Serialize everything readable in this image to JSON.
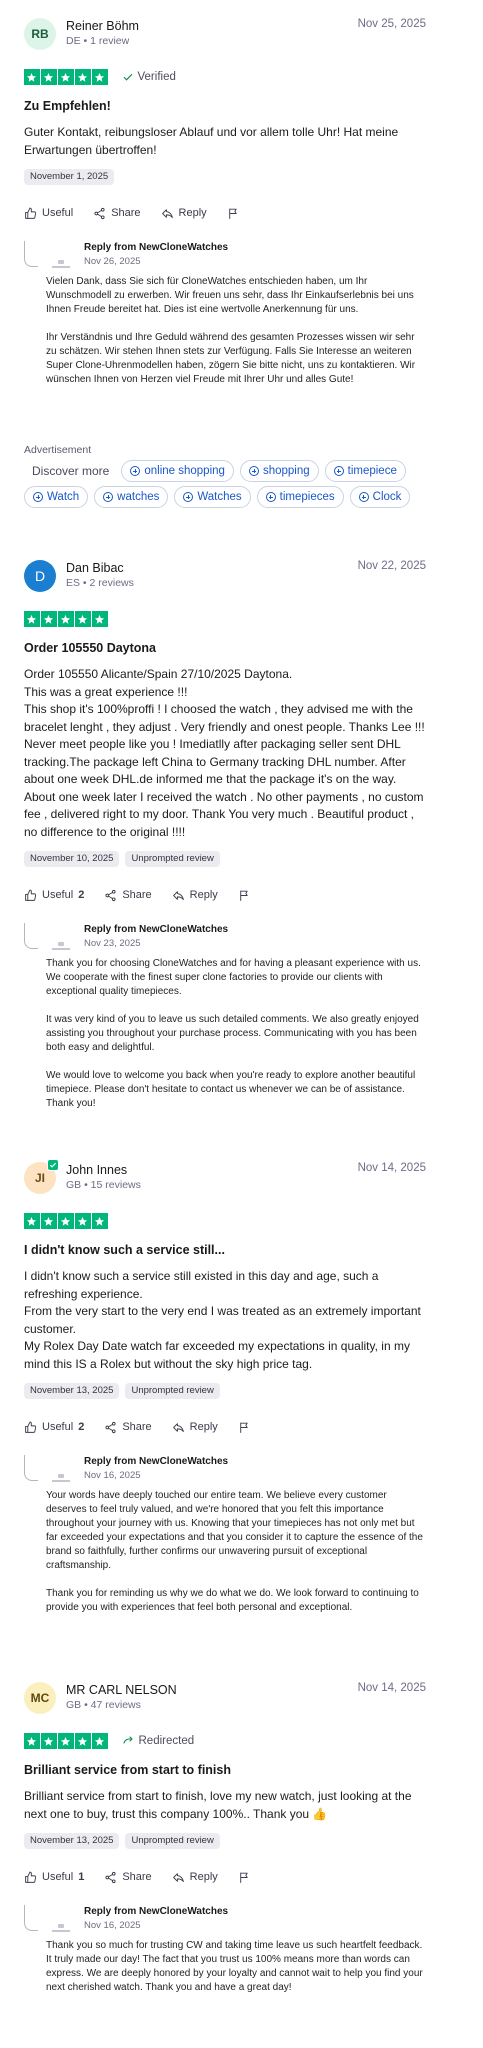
{
  "colors": {
    "star": "#00b67a",
    "link": "#1a57c9"
  },
  "actions": {
    "useful": "Useful",
    "share": "Share",
    "reply": "Reply"
  },
  "reviews": [
    {
      "initials": "RB",
      "avatar_bg": "#dcf5e8",
      "avatar_fg": "#1e5b3a",
      "name": "Reiner Böhm",
      "meta": "DE • 1 review",
      "date": "Nov 25, 2025",
      "rating": 5,
      "status": "Verified",
      "title": "Zu Empfehlen!",
      "body": "Guter Kontakt, reibungsloser Ablauf und vor allem tolle Uhr! Hat meine Erwartungen übertroffen!",
      "tags": [
        "November 1, 2025"
      ],
      "useful_count": "",
      "reply": {
        "from": "Reply from NewCloneWatches",
        "date": "Nov 26, 2025",
        "body": "Vielen Dank, dass Sie sich für CloneWatches entschieden haben, um Ihr Wunschmodell zu erwerben. Wir freuen uns sehr, dass Ihr Einkaufserlebnis bei uns Ihnen Freude bereitet hat. Dies ist eine wertvolle Anerkennung für uns.\n\nIhr Verständnis und Ihre Geduld während des gesamten Prozesses wissen wir sehr zu schätzen. Wir stehen Ihnen stets zur Verfügung. Falls Sie Interesse an weiteren Super Clone-Uhrenmodellen haben, zögern Sie bitte nicht, uns zu kontaktieren. Wir wünschen Ihnen von Herzen viel Freude mit Ihrer Uhr und alles Gute!"
      }
    },
    {
      "initials": "D",
      "avatar_bg": "#1b7ed1",
      "avatar_fg": "#ffffff",
      "name": "Dan Bibac",
      "meta": "ES • 2 reviews",
      "date": "Nov 22, 2025",
      "rating": 5,
      "status": "",
      "title": "Order 105550 Daytona",
      "body": "Order 105550 Alicante/Spain 27/10/2025 Daytona.\nThis was a great experience !!!\nThis shop it's 100%proffi ! I choosed the watch , they advised me with the bracelet lenght , they adjust . Very friendly and onest people. Thanks Lee !!! Never meet people like you ! Imediatlly after packaging seller sent DHL tracking.The package left China to Germany tracking DHL number. After about one week DHL.de informed me that the package it's on the way. About one week later I received the watch . No other payments , no custom fee , delivered right to my door. Thank You very much . Beautiful product , no difference to the original !!!!",
      "tags": [
        "November 10, 2025",
        "Unprompted review"
      ],
      "useful_count": "2",
      "reply": {
        "from": "Reply from NewCloneWatches",
        "date": "Nov 23, 2025",
        "body": "Thank you for choosing CloneWatches and for having a pleasant experience with us. We cooperate with the finest super clone factories to provide our clients with exceptional quality timepieces.\n\nIt was very kind of you to leave us such detailed comments. We also greatly enjoyed assisting you throughout your purchase process. Communicating with you has been both easy and delightful.\n\nWe would love to welcome you back when you're ready to explore another beautiful timepiece. Please don't hesitate to contact us whenever we can be of assistance. Thank you!"
      }
    },
    {
      "initials": "JI",
      "avatar_bg": "#fde3c2",
      "avatar_fg": "#6b4a1b",
      "name": "John Innes",
      "meta": "GB • 15 reviews",
      "date": "Nov 14, 2025",
      "rating": 5,
      "status": "",
      "title": "I didn't know such a service still...",
      "body": "I didn't know such a service still existed in this day and age, such a refreshing experience.\nFrom the very start to the very end I was treated as an extremely important customer.\nMy Rolex Day Date watch far exceeded my expectations in quality, in my mind this IS a Rolex but without the sky high price tag.",
      "tags": [
        "November 13, 2025",
        "Unprompted review"
      ],
      "useful_count": "2",
      "reply": {
        "from": "Reply from NewCloneWatches",
        "date": "Nov 16, 2025",
        "body": "Your words have deeply touched our entire team. We believe every customer deserves to feel truly valued, and we're honored that you felt this importance throughout your journey with us. Knowing that your timepieces has not only met but far exceeded your expectations and that you consider it to capture the essence of the brand so faithfully, further confirms our unwavering pursuit of exceptional craftsmanship.\n\nThank you for reminding us why we do what we do. We look forward to continuing to provide you with experiences that feel both personal and exceptional."
      }
    },
    {
      "initials": "MC",
      "avatar_bg": "#fbf0bd",
      "avatar_fg": "#5d4a10",
      "name": "MR CARL NELSON",
      "meta": "GB • 47 reviews",
      "date": "Nov 14, 2025",
      "rating": 5,
      "status": "Redirected",
      "title": "Brilliant service from start to finish",
      "body": "Brilliant service from start to finish, love my new watch, just looking at the next one to buy, trust this company 100%.. Thank you 👍",
      "tags": [
        "November 13, 2025",
        "Unprompted review"
      ],
      "useful_count": "1",
      "reply": {
        "from": "Reply from NewCloneWatches",
        "date": "Nov 16, 2025",
        "body": "Thank you so much for trusting CW and taking time leave us such heartfelt feedback. It truly made our day! The fact that you trust us 100% means more than words can express. We are deeply honored by your loyalty and cannot wait to help you find your next cherished watch. Thank you and have a great day!"
      }
    }
  ],
  "ad": {
    "label": "Advertisement",
    "discover": "Discover more",
    "row1": [
      "online shopping",
      "shopping",
      "timepiece"
    ],
    "row2": [
      "Watch",
      "watches",
      "Watches",
      "timepieces",
      "Clock"
    ]
  }
}
